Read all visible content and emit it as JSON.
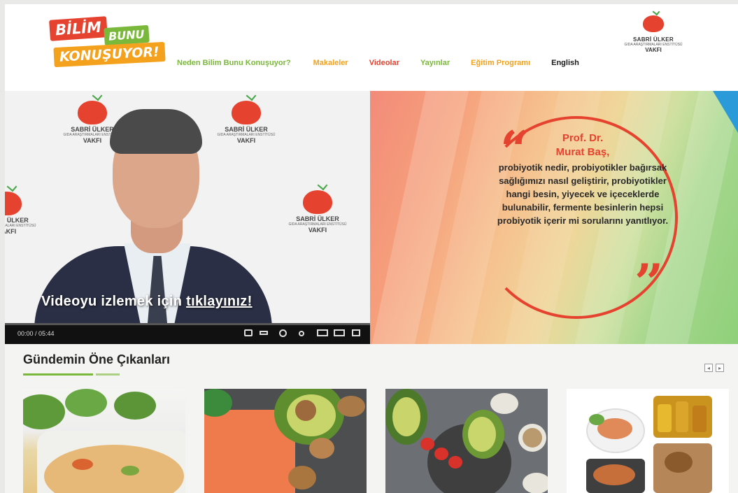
{
  "brand": {
    "logo_line1": "BİLİM",
    "logo_line2": "BUNU",
    "logo_line3": "KONUŞUYOR!"
  },
  "nav": {
    "items": [
      "Neden Bilim Bunu Konuşuyor?",
      "Makaleler",
      "Videolar",
      "Yayınlar",
      "Eğitim Programı",
      "English"
    ]
  },
  "sponsor": {
    "name": "SABRİ ÜLKER",
    "subtitle": "GIDA ARAŞTIRMALARI ENSTİTÜSÜ",
    "org": "VAKFI"
  },
  "video": {
    "cta_prefix": "Videoyu izlemek için ",
    "cta_link": "tıklayınız!",
    "time": "00:00 / 05:44",
    "watermark_name": "SABRİ ÜLKER",
    "watermark_subtitle": "GIDA ARAŞTIRMALARI ENSTİTÜSÜ",
    "watermark_org": "VAKFI"
  },
  "quote": {
    "title": "Prof. Dr.",
    "name": "Murat Baş,",
    "text": "probiyotik nedir, probiyotikler bağırsak sağlığımızı nasıl geliştirir, probiyotikler hangi besin, yiyecek ve içeceklerde bulunabilir, fermente besinlerin hepsi probiyotik içerir mi sorularını yanıtlıyor."
  },
  "highlights": {
    "title": "Gündemin Öne Çıkanları"
  },
  "colors": {
    "red": "#e5432f",
    "green": "#7ab83b",
    "orange": "#f4a21d"
  }
}
